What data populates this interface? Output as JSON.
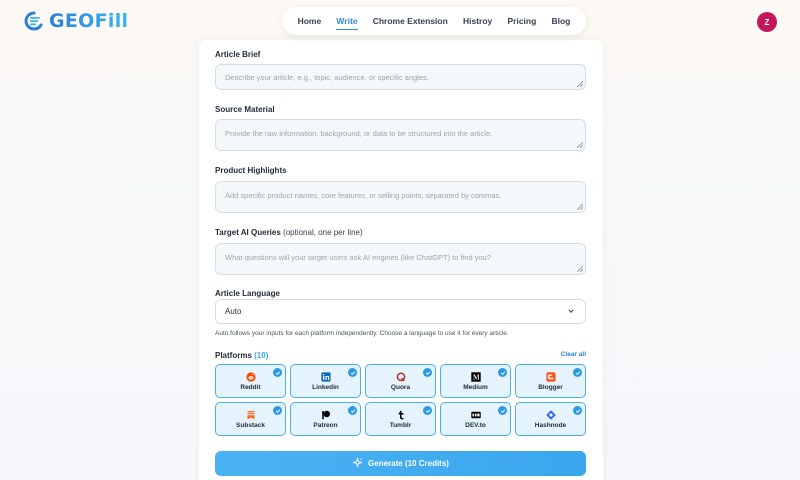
{
  "brand": {
    "name": "GEOFill"
  },
  "nav": {
    "items": [
      {
        "label": "Home",
        "active": false
      },
      {
        "label": "Write",
        "active": true
      },
      {
        "label": "Chrome Extension",
        "active": false
      },
      {
        "label": "Histroy",
        "active": false
      },
      {
        "label": "Pricing",
        "active": false
      },
      {
        "label": "Blog",
        "active": false
      }
    ]
  },
  "user": {
    "initial": "Z",
    "color": "#c2185b"
  },
  "form": {
    "brief": {
      "label": "Article Brief",
      "placeholder": "Describe your article, e.g., topic, audience, or specific angles."
    },
    "source": {
      "label": "Source Material",
      "placeholder": "Provide the raw information, background, or data to be structured into the article."
    },
    "highlights": {
      "label": "Product Highlights",
      "placeholder": "Add specific product names, core features, or selling points, separated by commas."
    },
    "queries": {
      "label": "Target AI Queries",
      "label_note": "(optional, one per line)",
      "placeholder": "What questions will your target users ask AI engines (like ChatGPT) to find you?"
    },
    "language": {
      "label": "Article Language",
      "value": "Auto",
      "hint": "Auto follows your inputs for each platform independently. Choose a language to use it for every article."
    }
  },
  "platforms": {
    "label": "Platforms",
    "count": "(10)",
    "clear_label": "Clear all",
    "items": [
      {
        "name": "Reddit",
        "icon": "reddit-icon",
        "color": "#ff4500",
        "selected": true
      },
      {
        "name": "Linkedin",
        "icon": "linkedin-icon",
        "color": "#0a66c2",
        "selected": true
      },
      {
        "name": "Quora",
        "icon": "quora-icon",
        "color": "#b92b27",
        "selected": true
      },
      {
        "name": "Medium",
        "icon": "medium-icon",
        "color": "#000000",
        "selected": true
      },
      {
        "name": "Blogger",
        "icon": "blogger-icon",
        "color": "#ff5722",
        "selected": true
      },
      {
        "name": "Substack",
        "icon": "substack-icon",
        "color": "#ff6719",
        "selected": true
      },
      {
        "name": "Patreon",
        "icon": "patreon-icon",
        "color": "#000000",
        "selected": true
      },
      {
        "name": "Tumblr",
        "icon": "tumblr-icon",
        "color": "#000000",
        "selected": true
      },
      {
        "name": "DEV.to",
        "icon": "devto-icon",
        "color": "#000000",
        "selected": true
      },
      {
        "name": "Hashnode",
        "icon": "hashnode-icon",
        "color": "#2962ff",
        "selected": true
      }
    ]
  },
  "generate": {
    "label": "Generate (10 Credits)"
  },
  "colors": {
    "accent": "#2b8de0",
    "tile_bg": "#e5f3fc",
    "tile_border": "#47b0ec",
    "button": "#3aa6ee"
  }
}
